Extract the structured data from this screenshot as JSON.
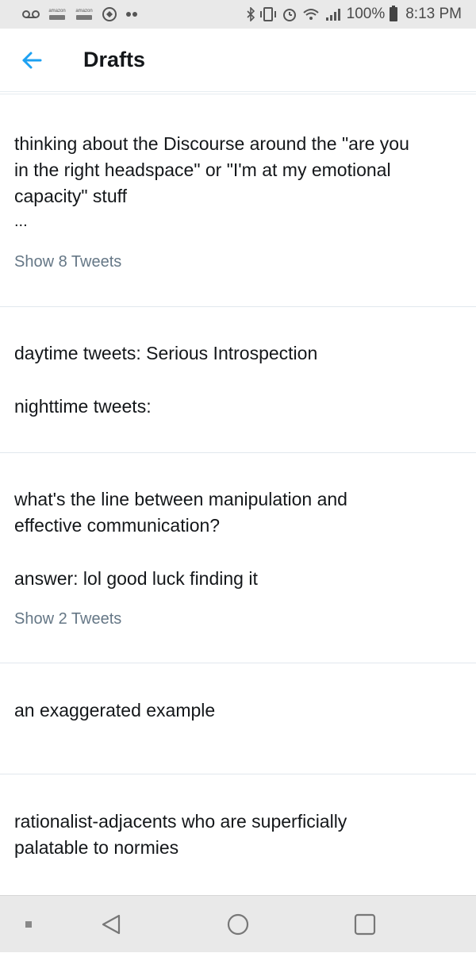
{
  "status_bar": {
    "left_icons": [
      "voicemail-icon",
      "amazon-icon",
      "amazon-icon",
      "android-icon",
      "dots-icon"
    ],
    "amazon_label": "amazon",
    "battery_text": "100%",
    "time": "8:13 PM"
  },
  "header": {
    "title": "Drafts",
    "back_icon": "arrow-left-icon",
    "accent": "#1da1f2"
  },
  "drafts": [
    {
      "lines": [
        "thinking about the Discourse around the \"are you",
        "in the right headspace\" or \"I'm at my emotional",
        "capacity\" stuff",
        "..."
      ],
      "show_label": "Show 8 Tweets"
    },
    {
      "lines": [
        "daytime tweets: Serious Introspection",
        "nighttime tweets:"
      ]
    },
    {
      "lines": [
        "what's the line between manipulation and",
        "effective communication?",
        "answer: lol good luck finding it"
      ],
      "show_label": "Show 2 Tweets"
    },
    {
      "lines": [
        "an exaggerated example"
      ]
    },
    {
      "lines": [
        "rationalist-adjacents who are superficially",
        "palatable to normies"
      ]
    }
  ],
  "nav_bar": {
    "buttons": [
      "menu-dot-icon",
      "back-triangle-icon",
      "home-circle-icon",
      "recents-square-icon"
    ]
  }
}
